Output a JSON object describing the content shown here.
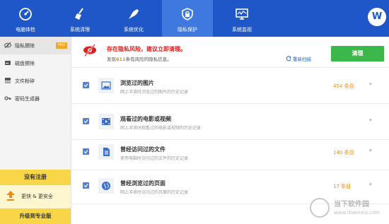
{
  "nav": {
    "tabs": [
      {
        "label": "电脑体检",
        "icon": "speedometer-icon"
      },
      {
        "label": "系统清理",
        "icon": "broom-icon"
      },
      {
        "label": "系统优化",
        "icon": "rocket-icon"
      },
      {
        "label": "隐私保护",
        "icon": "lock-shield-icon",
        "active": true
      },
      {
        "label": "系统监视",
        "icon": "monitor-icon"
      }
    ],
    "logo": "W"
  },
  "sidebar": {
    "items": [
      {
        "label": "隐私擦除",
        "icon": "eye-slash-icon",
        "badge": "PRO",
        "active": true
      },
      {
        "label": "磁盘擦除",
        "icon": "disk-icon"
      },
      {
        "label": "文件粉碎",
        "icon": "shredder-icon"
      },
      {
        "label": "密码生成器",
        "icon": "key-icon"
      }
    ],
    "promo": {
      "title": "没有注册",
      "text": "更快 & 更安全",
      "upgrade_label": "升级到专业版"
    }
  },
  "alert": {
    "title": "存在隐私风险，建议立即清理。",
    "sub_prefix": "发现",
    "count": "611",
    "sub_suffix": "条有风险的隐私信息。",
    "rescan_label": "重新扫描",
    "clean_label": "清理"
  },
  "items": [
    {
      "title": "浏览过的图片",
      "desc": "网上冲浪时浏览过的图片的历史记录",
      "count": "454 条目",
      "icon": "image-icon"
    },
    {
      "title": "观看过的电影或视频",
      "desc": "网上冲浪时观看过的电影或视频的历史记录",
      "count": "",
      "icon": "film-icon"
    },
    {
      "title": "曾经访问过的文件",
      "desc": "使用电脑时访问过的文件的历史记录",
      "count": "140 条目",
      "icon": "document-icon"
    },
    {
      "title": "曾经浏览过的页面",
      "desc": "网上冲浪时访问过的页面的历史记录",
      "count": "17 条目",
      "icon": "globe-icon"
    }
  ],
  "watermark": {
    "line1": "当下软件园",
    "line2": "www.downxia.com"
  },
  "colors": {
    "header": "#1f57c9",
    "active_tab": "#3f79e0",
    "clean_button": "#3cb84a",
    "alert": "#e21b1b",
    "count": "#f08a14",
    "promo": "#f9d648"
  }
}
